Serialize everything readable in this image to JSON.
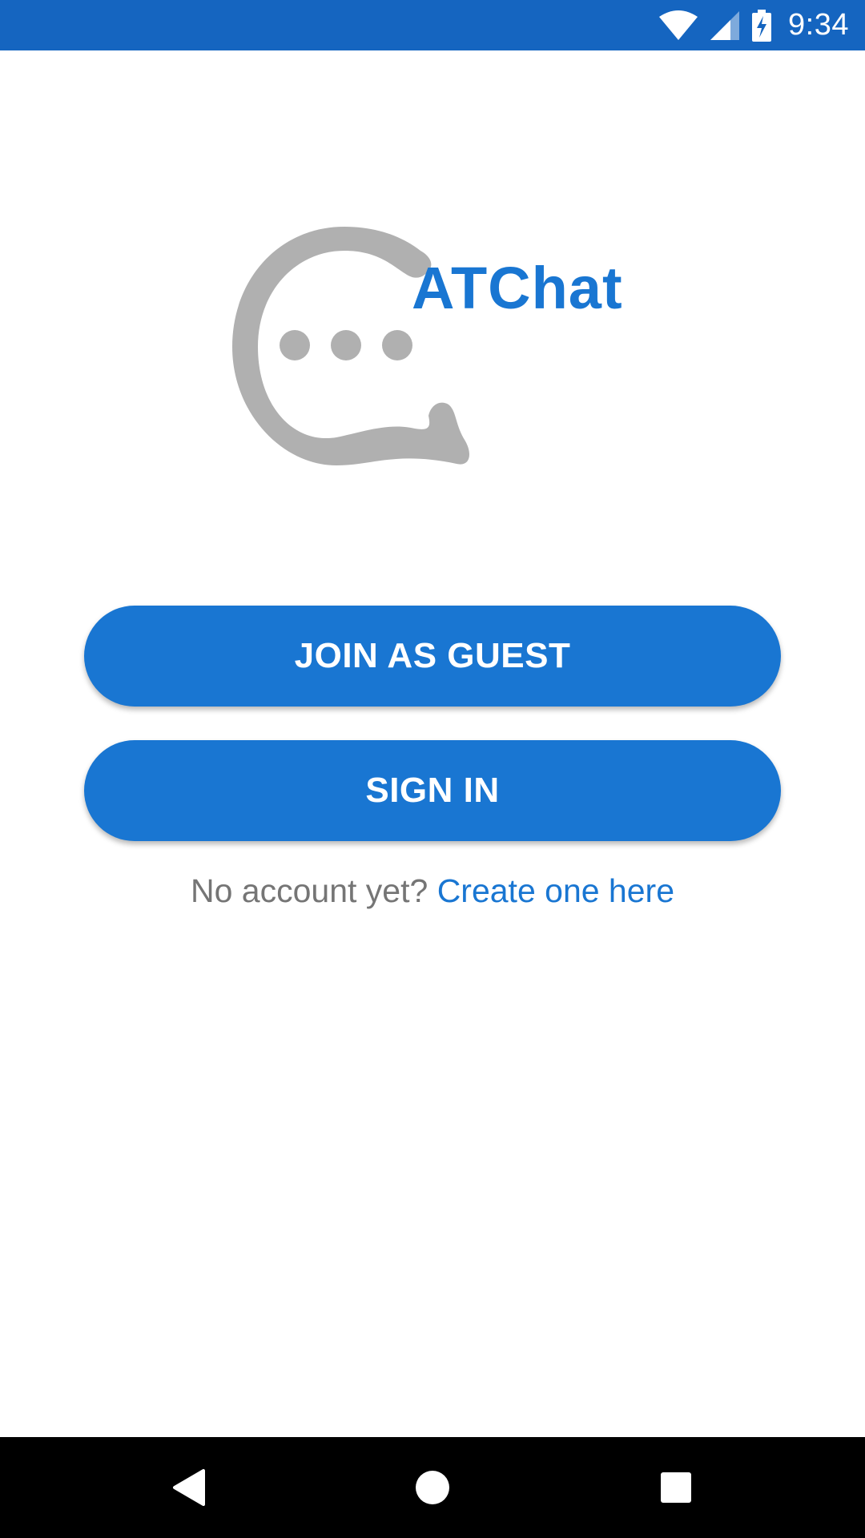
{
  "status_bar": {
    "time": "9:34",
    "icons": [
      "wifi-icon",
      "cell-signal-icon",
      "battery-charging-icon"
    ],
    "color": "#1565c0"
  },
  "logo": {
    "text": "ATChat",
    "text_color": "#1976d2",
    "mark_color": "#b0b0b0"
  },
  "actions": {
    "join_guest_label": "JOIN AS GUEST",
    "sign_in_label": "SIGN IN",
    "button_color": "#1976d2"
  },
  "signup": {
    "prompt": "No account yet?",
    "link_label": "Create one here"
  },
  "nav_bar": {
    "icons": [
      "back-icon",
      "home-icon",
      "recents-icon"
    ]
  }
}
